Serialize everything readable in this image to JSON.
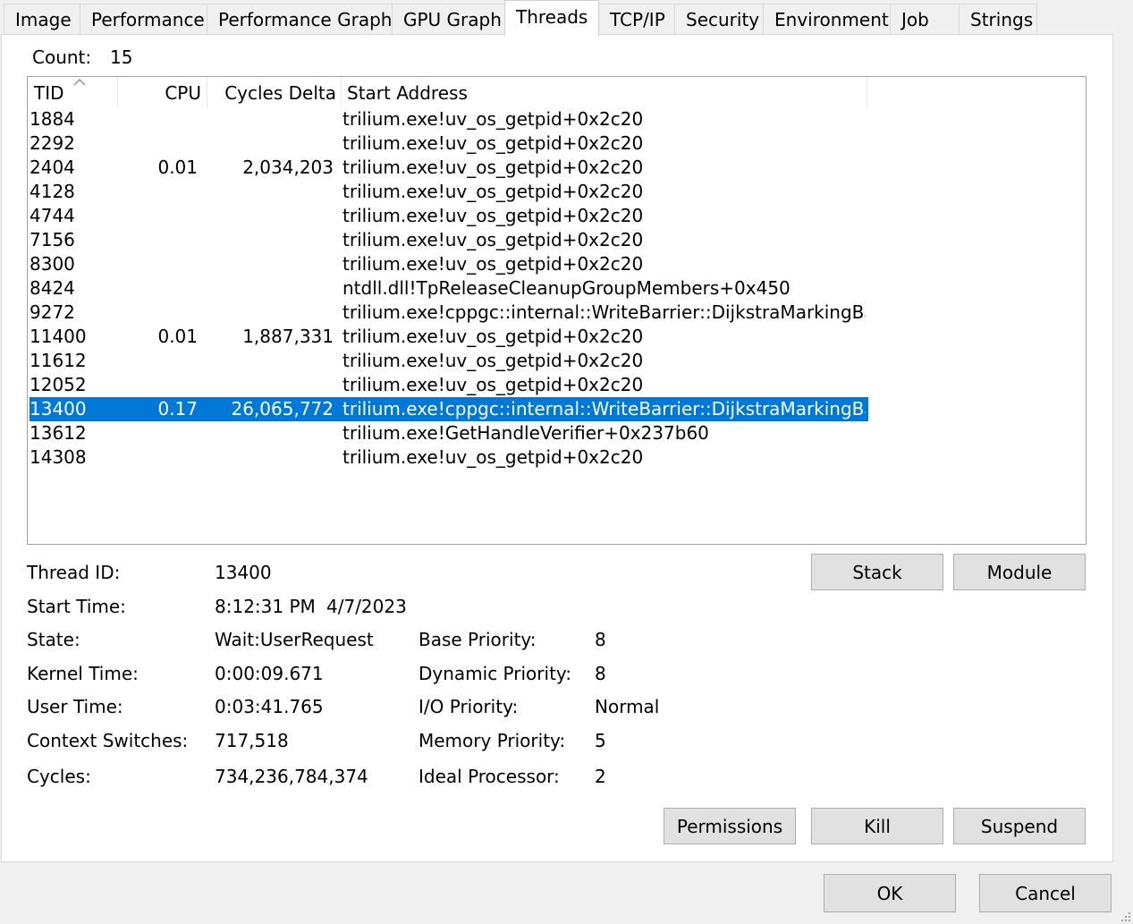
{
  "tabs": [
    {
      "label": "Image"
    },
    {
      "label": "Performance"
    },
    {
      "label": "Performance Graph"
    },
    {
      "label": "GPU Graph"
    },
    {
      "label": "Threads"
    },
    {
      "label": "TCP/IP"
    },
    {
      "label": "Security"
    },
    {
      "label": "Environment"
    },
    {
      "label": "Job"
    },
    {
      "label": "Strings"
    }
  ],
  "count": {
    "label": "Count:",
    "value": "15"
  },
  "columns": {
    "tid": "TID",
    "cpu": "CPU",
    "cycles": "Cycles Delta",
    "start": "Start Address"
  },
  "threads": [
    {
      "tid": "1884",
      "cpu": "",
      "cycles": "",
      "start": "trilium.exe!uv_os_getpid+0x2c20"
    },
    {
      "tid": "2292",
      "cpu": "",
      "cycles": "",
      "start": "trilium.exe!uv_os_getpid+0x2c20"
    },
    {
      "tid": "2404",
      "cpu": "0.01",
      "cycles": "2,034,203",
      "start": "trilium.exe!uv_os_getpid+0x2c20"
    },
    {
      "tid": "4128",
      "cpu": "",
      "cycles": "",
      "start": "trilium.exe!uv_os_getpid+0x2c20"
    },
    {
      "tid": "4744",
      "cpu": "",
      "cycles": "",
      "start": "trilium.exe!uv_os_getpid+0x2c20"
    },
    {
      "tid": "7156",
      "cpu": "",
      "cycles": "",
      "start": "trilium.exe!uv_os_getpid+0x2c20"
    },
    {
      "tid": "8300",
      "cpu": "",
      "cycles": "",
      "start": "trilium.exe!uv_os_getpid+0x2c20"
    },
    {
      "tid": "8424",
      "cpu": "",
      "cycles": "",
      "start": "ntdll.dll!TpReleaseCleanupGroupMembers+0x450"
    },
    {
      "tid": "9272",
      "cpu": "",
      "cycles": "",
      "start": "trilium.exe!cppgc::internal::WriteBarrier::DijkstraMarkingBa..."
    },
    {
      "tid": "11400",
      "cpu": "0.01",
      "cycles": "1,887,331",
      "start": "trilium.exe!uv_os_getpid+0x2c20"
    },
    {
      "tid": "11612",
      "cpu": "",
      "cycles": "",
      "start": "trilium.exe!uv_os_getpid+0x2c20"
    },
    {
      "tid": "12052",
      "cpu": "",
      "cycles": "",
      "start": "trilium.exe!uv_os_getpid+0x2c20"
    },
    {
      "tid": "13400",
      "cpu": "0.17",
      "cycles": "26,065,772",
      "start": "trilium.exe!cppgc::internal::WriteBarrier::DijkstraMarkingBa...",
      "selected": true
    },
    {
      "tid": "13612",
      "cpu": "",
      "cycles": "",
      "start": "trilium.exe!GetHandleVerifier+0x237b60"
    },
    {
      "tid": "14308",
      "cpu": "",
      "cycles": "",
      "start": "trilium.exe!uv_os_getpid+0x2c20"
    }
  ],
  "details": {
    "thread_id_label": "Thread ID:",
    "thread_id": "13400",
    "start_time_label": "Start Time:",
    "start_time": "8:12:31 PM",
    "start_date": "4/7/2023",
    "state_label": "State:",
    "state": "Wait:UserRequest",
    "kernel_time_label": "Kernel Time:",
    "kernel_time": "0:00:09.671",
    "user_time_label": "User Time:",
    "user_time": "0:03:41.765",
    "context_switches_label": "Context Switches:",
    "context_switches": "717,518",
    "cycles_label": "Cycles:",
    "cycles": "734,236,784,374",
    "base_priority_label": "Base Priority:",
    "base_priority": "8",
    "dynamic_priority_label": "Dynamic Priority:",
    "dynamic_priority": "8",
    "io_priority_label": "I/O Priority:",
    "io_priority": "Normal",
    "memory_priority_label": "Memory Priority:",
    "memory_priority": "5",
    "ideal_processor_label": "Ideal Processor:",
    "ideal_processor": "2"
  },
  "buttons": {
    "stack": "Stack",
    "module": "Module",
    "permissions": "Permissions",
    "kill": "Kill",
    "suspend": "Suspend",
    "ok": "OK",
    "cancel": "Cancel"
  },
  "colors": {
    "selection": "#0078d7",
    "background": "#f0f0f0",
    "panel": "#ffffff"
  }
}
